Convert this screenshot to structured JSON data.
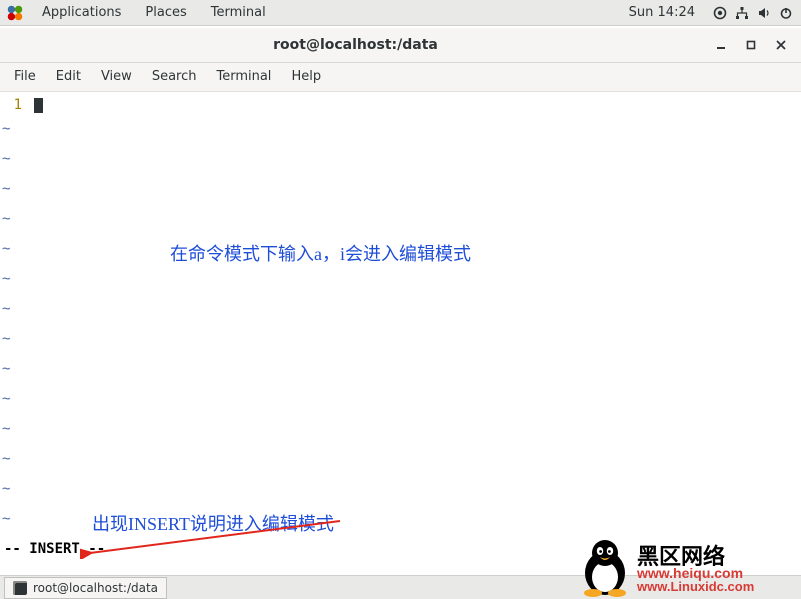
{
  "panel": {
    "applications": "Applications",
    "places": "Places",
    "terminal": "Terminal",
    "clock": "Sun 14:24"
  },
  "window": {
    "title": "root@localhost:/data"
  },
  "menubar": {
    "file": "File",
    "edit": "Edit",
    "view": "View",
    "search": "Search",
    "terminal": "Terminal",
    "help": "Help"
  },
  "editor": {
    "line_number": "1",
    "annotation1": "在命令模式下输入a，i会进入编辑模式",
    "annotation2": "出现INSERT说明进入编辑模式",
    "status": "-- INSERT --"
  },
  "taskbar": {
    "item1": "root@localhost:/data"
  },
  "watermark": {
    "line1": "黑区网络",
    "line2": "www.heiqu.com",
    "line3": "www.Linuxidc.com"
  }
}
